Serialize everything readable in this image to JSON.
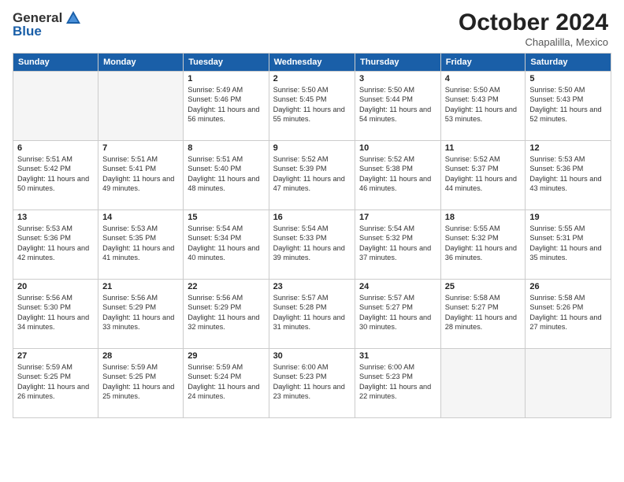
{
  "header": {
    "logo_general": "General",
    "logo_blue": "Blue",
    "month_title": "October 2024",
    "subtitle": "Chapalilla, Mexico"
  },
  "weekdays": [
    "Sunday",
    "Monday",
    "Tuesday",
    "Wednesday",
    "Thursday",
    "Friday",
    "Saturday"
  ],
  "weeks": [
    [
      {
        "day": "",
        "info": ""
      },
      {
        "day": "",
        "info": ""
      },
      {
        "day": "1",
        "info": "Sunrise: 5:49 AM\nSunset: 5:46 PM\nDaylight: 11 hours and 56 minutes."
      },
      {
        "day": "2",
        "info": "Sunrise: 5:50 AM\nSunset: 5:45 PM\nDaylight: 11 hours and 55 minutes."
      },
      {
        "day": "3",
        "info": "Sunrise: 5:50 AM\nSunset: 5:44 PM\nDaylight: 11 hours and 54 minutes."
      },
      {
        "day": "4",
        "info": "Sunrise: 5:50 AM\nSunset: 5:43 PM\nDaylight: 11 hours and 53 minutes."
      },
      {
        "day": "5",
        "info": "Sunrise: 5:50 AM\nSunset: 5:43 PM\nDaylight: 11 hours and 52 minutes."
      }
    ],
    [
      {
        "day": "6",
        "info": "Sunrise: 5:51 AM\nSunset: 5:42 PM\nDaylight: 11 hours and 50 minutes."
      },
      {
        "day": "7",
        "info": "Sunrise: 5:51 AM\nSunset: 5:41 PM\nDaylight: 11 hours and 49 minutes."
      },
      {
        "day": "8",
        "info": "Sunrise: 5:51 AM\nSunset: 5:40 PM\nDaylight: 11 hours and 48 minutes."
      },
      {
        "day": "9",
        "info": "Sunrise: 5:52 AM\nSunset: 5:39 PM\nDaylight: 11 hours and 47 minutes."
      },
      {
        "day": "10",
        "info": "Sunrise: 5:52 AM\nSunset: 5:38 PM\nDaylight: 11 hours and 46 minutes."
      },
      {
        "day": "11",
        "info": "Sunrise: 5:52 AM\nSunset: 5:37 PM\nDaylight: 11 hours and 44 minutes."
      },
      {
        "day": "12",
        "info": "Sunrise: 5:53 AM\nSunset: 5:36 PM\nDaylight: 11 hours and 43 minutes."
      }
    ],
    [
      {
        "day": "13",
        "info": "Sunrise: 5:53 AM\nSunset: 5:36 PM\nDaylight: 11 hours and 42 minutes."
      },
      {
        "day": "14",
        "info": "Sunrise: 5:53 AM\nSunset: 5:35 PM\nDaylight: 11 hours and 41 minutes."
      },
      {
        "day": "15",
        "info": "Sunrise: 5:54 AM\nSunset: 5:34 PM\nDaylight: 11 hours and 40 minutes."
      },
      {
        "day": "16",
        "info": "Sunrise: 5:54 AM\nSunset: 5:33 PM\nDaylight: 11 hours and 39 minutes."
      },
      {
        "day": "17",
        "info": "Sunrise: 5:54 AM\nSunset: 5:32 PM\nDaylight: 11 hours and 37 minutes."
      },
      {
        "day": "18",
        "info": "Sunrise: 5:55 AM\nSunset: 5:32 PM\nDaylight: 11 hours and 36 minutes."
      },
      {
        "day": "19",
        "info": "Sunrise: 5:55 AM\nSunset: 5:31 PM\nDaylight: 11 hours and 35 minutes."
      }
    ],
    [
      {
        "day": "20",
        "info": "Sunrise: 5:56 AM\nSunset: 5:30 PM\nDaylight: 11 hours and 34 minutes."
      },
      {
        "day": "21",
        "info": "Sunrise: 5:56 AM\nSunset: 5:29 PM\nDaylight: 11 hours and 33 minutes."
      },
      {
        "day": "22",
        "info": "Sunrise: 5:56 AM\nSunset: 5:29 PM\nDaylight: 11 hours and 32 minutes."
      },
      {
        "day": "23",
        "info": "Sunrise: 5:57 AM\nSunset: 5:28 PM\nDaylight: 11 hours and 31 minutes."
      },
      {
        "day": "24",
        "info": "Sunrise: 5:57 AM\nSunset: 5:27 PM\nDaylight: 11 hours and 30 minutes."
      },
      {
        "day": "25",
        "info": "Sunrise: 5:58 AM\nSunset: 5:27 PM\nDaylight: 11 hours and 28 minutes."
      },
      {
        "day": "26",
        "info": "Sunrise: 5:58 AM\nSunset: 5:26 PM\nDaylight: 11 hours and 27 minutes."
      }
    ],
    [
      {
        "day": "27",
        "info": "Sunrise: 5:59 AM\nSunset: 5:25 PM\nDaylight: 11 hours and 26 minutes."
      },
      {
        "day": "28",
        "info": "Sunrise: 5:59 AM\nSunset: 5:25 PM\nDaylight: 11 hours and 25 minutes."
      },
      {
        "day": "29",
        "info": "Sunrise: 5:59 AM\nSunset: 5:24 PM\nDaylight: 11 hours and 24 minutes."
      },
      {
        "day": "30",
        "info": "Sunrise: 6:00 AM\nSunset: 5:23 PM\nDaylight: 11 hours and 23 minutes."
      },
      {
        "day": "31",
        "info": "Sunrise: 6:00 AM\nSunset: 5:23 PM\nDaylight: 11 hours and 22 minutes."
      },
      {
        "day": "",
        "info": ""
      },
      {
        "day": "",
        "info": ""
      }
    ]
  ]
}
